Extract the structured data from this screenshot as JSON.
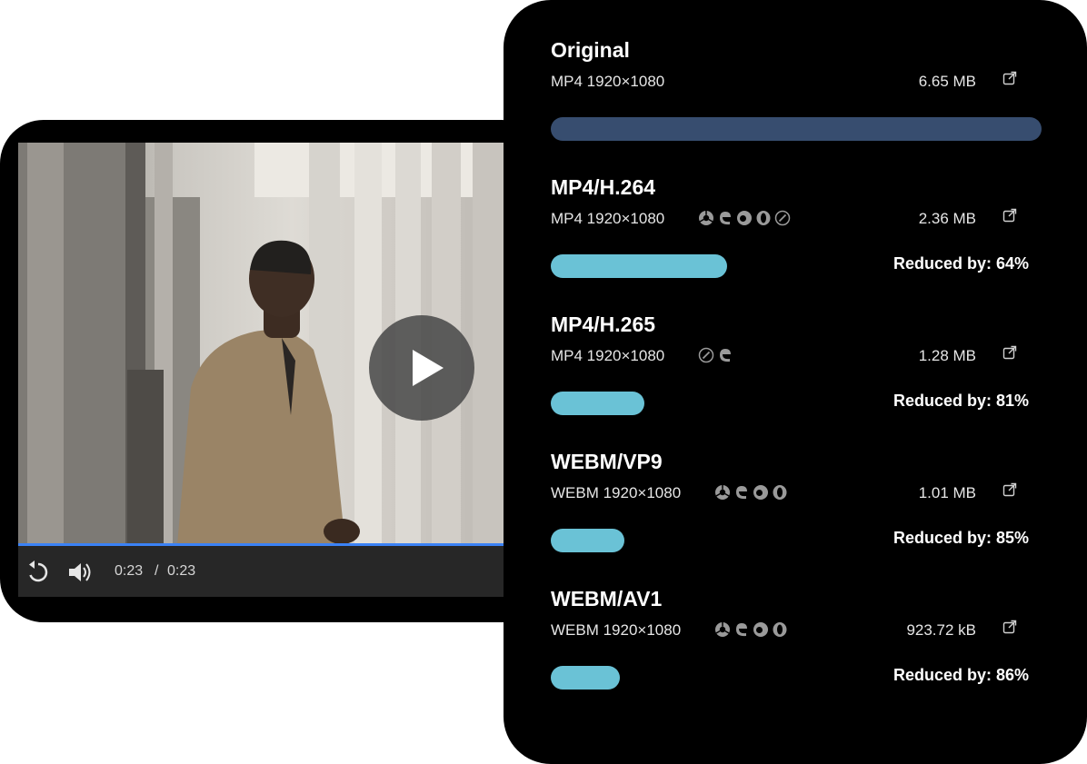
{
  "player": {
    "time_current": "0:23",
    "time_separator": "/",
    "time_total": "0:23",
    "progress": 1.0,
    "accent": "#3b82f6",
    "icons": {
      "replay": "replay-icon",
      "volume": "volume-icon",
      "play": "play-icon"
    }
  },
  "formats": [
    {
      "title": "Original",
      "meta": "MP4 1920×1080",
      "browsers": [],
      "size": "6.65 MB",
      "bar_fraction": 1.0,
      "bar_color": "#374d6f",
      "reduced": ""
    },
    {
      "title": "MP4/H.264",
      "meta": "MP4 1920×1080",
      "browsers": [
        "chrome-icon",
        "edge-icon",
        "firefox-icon",
        "opera-icon",
        "safari-icon"
      ],
      "size": "2.36 MB",
      "bar_fraction": 0.36,
      "bar_color": "#6ac2d6",
      "reduced": "Reduced by: 64%"
    },
    {
      "title": "MP4/H.265",
      "meta": "MP4 1920×1080",
      "browsers": [
        "safari-icon",
        "edge-icon"
      ],
      "size": "1.28 MB",
      "bar_fraction": 0.19,
      "bar_color": "#6ac2d6",
      "reduced": "Reduced by: 81%"
    },
    {
      "title": "WEBM/VP9",
      "meta": "WEBM 1920×1080",
      "browsers": [
        "chrome-icon",
        "edge-icon",
        "firefox-icon",
        "opera-icon"
      ],
      "size": "1.01 MB",
      "bar_fraction": 0.15,
      "bar_color": "#6ac2d6",
      "reduced": "Reduced by: 85%"
    },
    {
      "title": "WEBM/AV1",
      "meta": "WEBM 1920×1080",
      "browsers": [
        "chrome-icon",
        "edge-icon",
        "firefox-icon",
        "opera-icon"
      ],
      "size": "923.72 kB",
      "bar_fraction": 0.14,
      "bar_color": "#6ac2d6",
      "reduced": "Reduced by: 86%"
    }
  ]
}
